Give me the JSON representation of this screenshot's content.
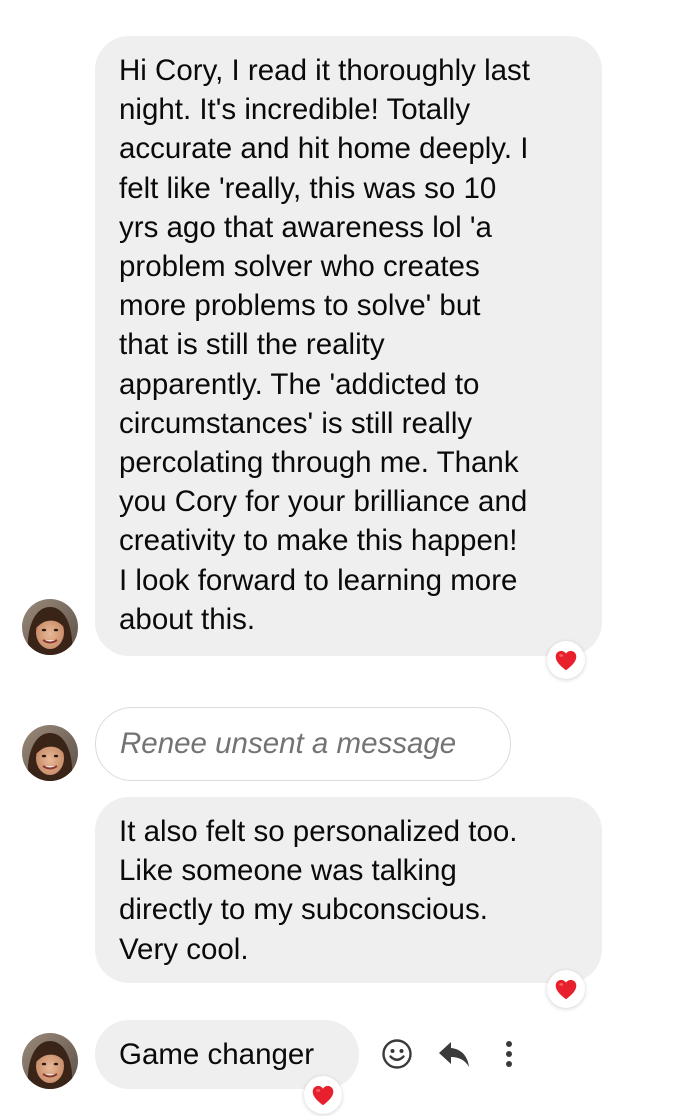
{
  "messages": [
    {
      "lines": [
        "Hi Cory, I read it thoroughly last",
        "night. It's incredible! Totally",
        "accurate and hit home deeply. I",
        "felt like 'really, this was so 10",
        "yrs ago that awareness lol 'a",
        "problem solver who creates",
        "more problems to solve' but",
        "that is still the reality",
        "apparently. The 'addicted to",
        "circumstances' is still really",
        "percolating through me. Thank",
        "you Cory for your brilliance and",
        "creativity to make this happen!",
        "I look forward to learning more",
        "about this."
      ],
      "reaction": "heart"
    },
    {
      "unsent_text": "Renee unsent a message"
    },
    {
      "lines": [
        "It also felt so personalized too.",
        "Like someone was talking",
        "directly to my subconscious.",
        "Very cool."
      ],
      "reaction": "heart"
    },
    {
      "lines": [
        "Game changer"
      ],
      "reaction": "heart"
    }
  ],
  "message_actions": {
    "icons": [
      "smiley-icon",
      "reply-icon",
      "more-vertical-icon"
    ]
  },
  "colors": {
    "bubble": "#efefef",
    "unsent_border": "#dcdcdc",
    "unsent_text": "#737373",
    "heart": "#e8202e",
    "action_icon": "#3a3a3a"
  }
}
